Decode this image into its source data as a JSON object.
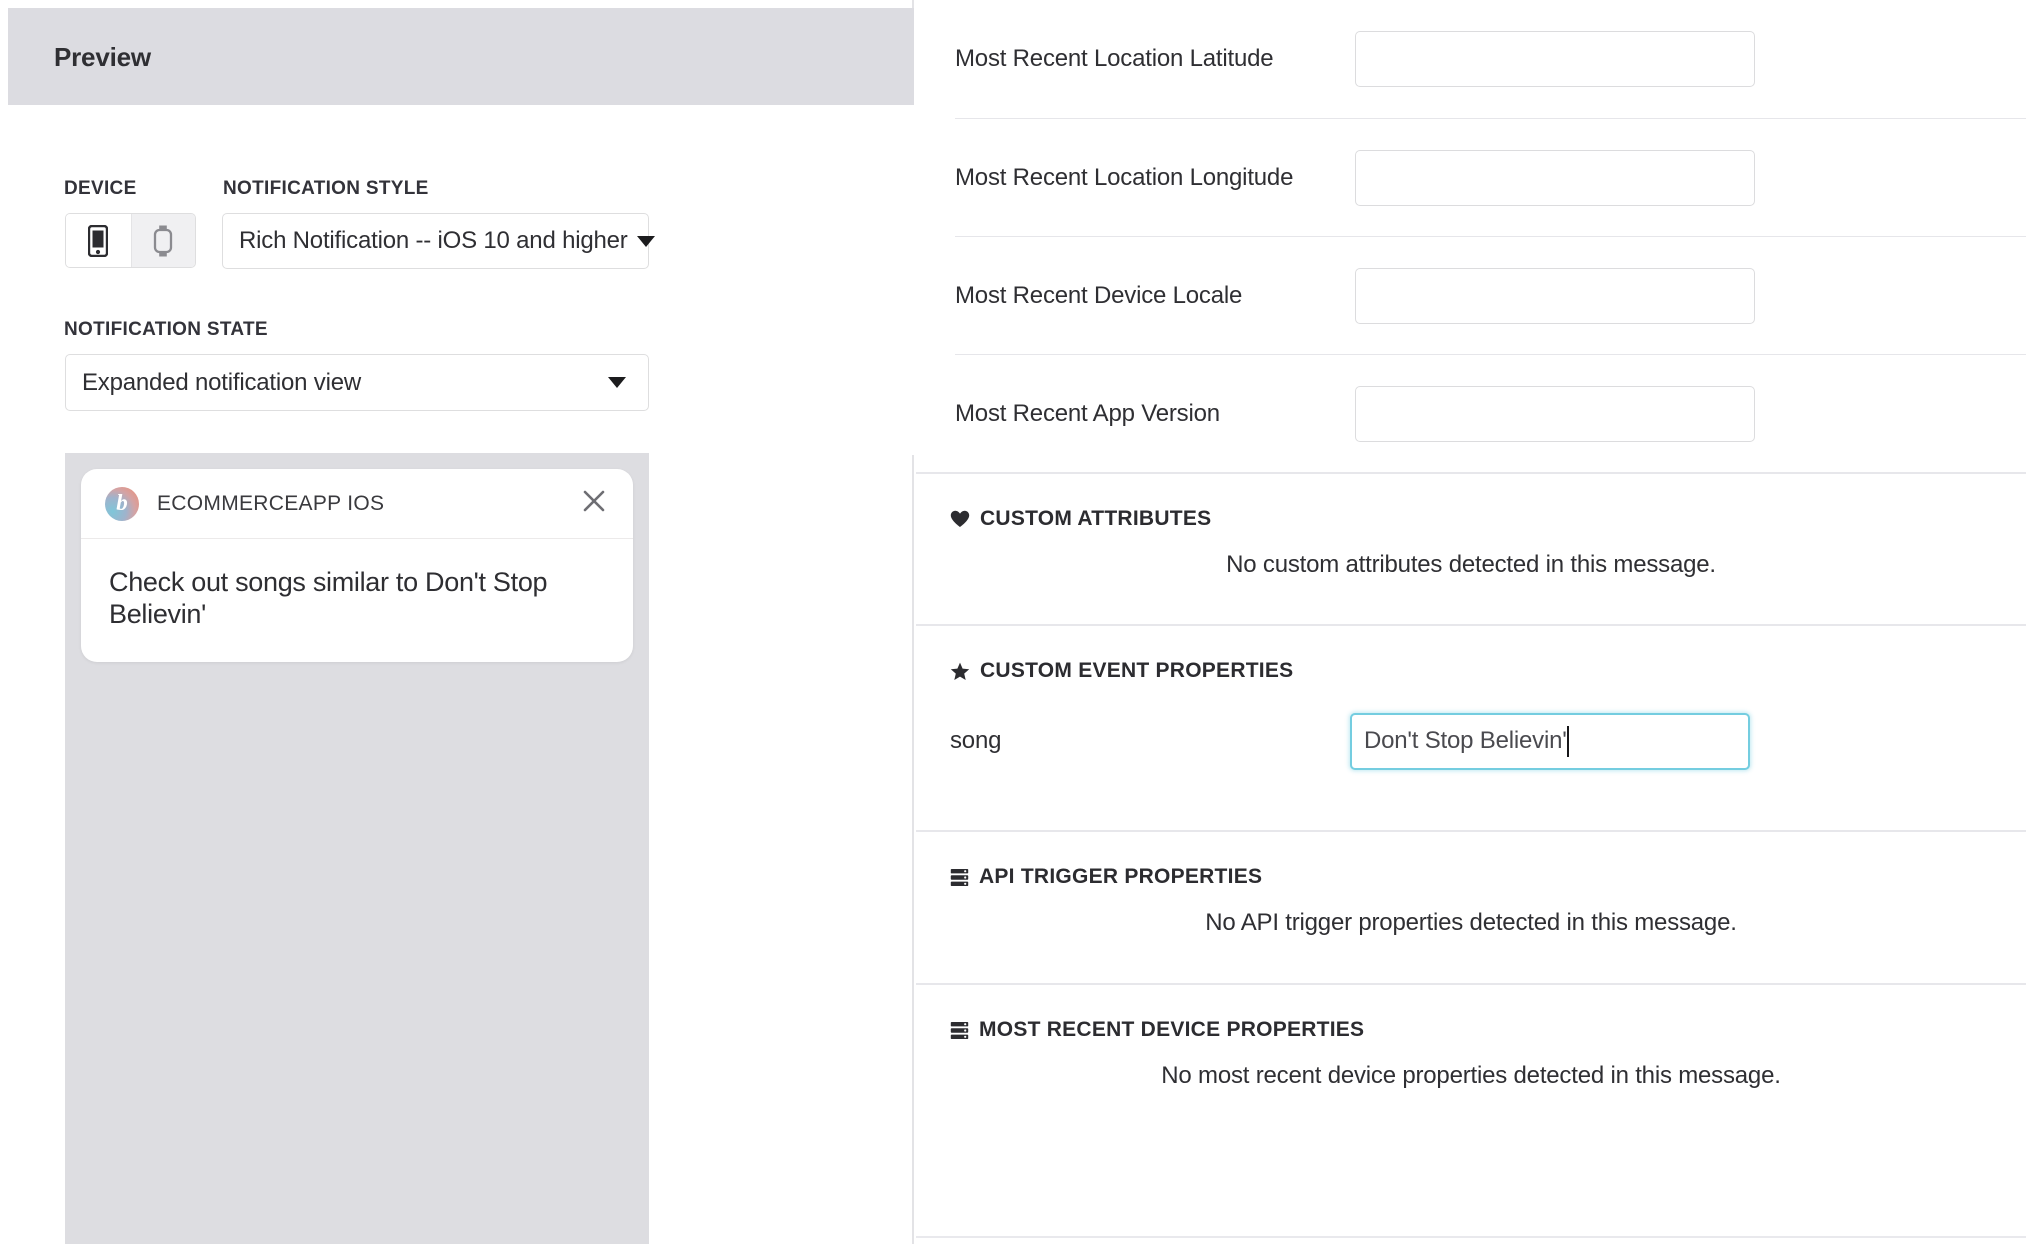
{
  "left_panel": {
    "header_title": "Preview",
    "accent_color": "#2c3b88",
    "device": {
      "label": "DEVICE",
      "options": [
        {
          "name": "phone",
          "icon": "phone-icon",
          "selected": true
        },
        {
          "name": "watch",
          "icon": "watch-icon",
          "selected": false
        }
      ]
    },
    "notification_style": {
      "label": "NOTIFICATION STYLE",
      "selected": "Rich Notification -- iOS 10 and higher"
    },
    "notification_state": {
      "label": "NOTIFICATION STATE",
      "selected": "Expanded notification view"
    },
    "notification_card": {
      "app_logo_glyph": "b",
      "app_name": "ECOMMERCEAPP IOS",
      "close_icon": "close-icon",
      "message": "Check out songs similar to Don't Stop Believin'"
    }
  },
  "right_panel": {
    "attributes": [
      {
        "label": "Most Recent Location Latitude",
        "value": "",
        "placeholder": ""
      },
      {
        "label": "Most Recent Location Longitude",
        "value": "",
        "placeholder": ""
      },
      {
        "label": "Most Recent Device Locale",
        "value": "",
        "placeholder": ""
      },
      {
        "label": "Most Recent App Version",
        "value": "",
        "placeholder": ""
      }
    ],
    "sections": {
      "custom_attributes": {
        "icon": "heart-icon",
        "title": "CUSTOM ATTRIBUTES",
        "empty_message": "No custom attributes detected in this message."
      },
      "custom_event_properties": {
        "icon": "star-icon",
        "title": "CUSTOM EVENT PROPERTIES",
        "property_key": "song",
        "property_value": "Don't Stop Believin'",
        "focus_color": "#74cde0"
      },
      "api_trigger_properties": {
        "icon": "server-stack-icon",
        "title": "API TRIGGER PROPERTIES",
        "empty_message": "No API trigger properties detected in this message."
      },
      "most_recent_device_properties": {
        "icon": "server-stack-icon",
        "title": "MOST RECENT DEVICE PROPERTIES",
        "empty_message": "No most recent device properties detected in this message."
      }
    }
  }
}
